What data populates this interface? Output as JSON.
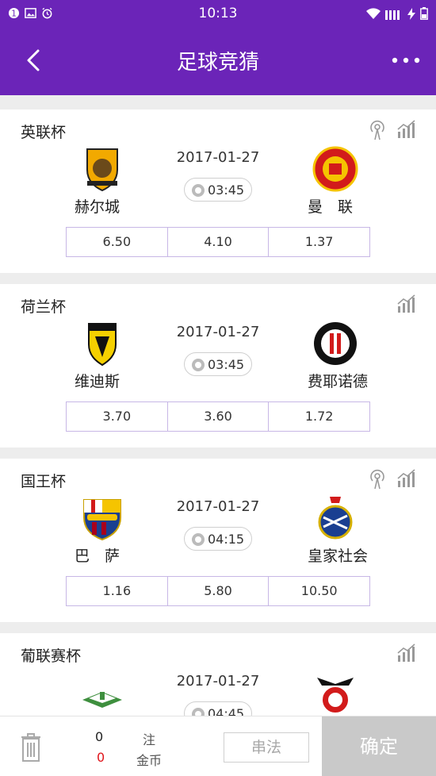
{
  "status_bar": {
    "time": "10:13",
    "left_icons": [
      "notification-badge-icon",
      "image-icon",
      "alarm-icon"
    ],
    "right_icons": [
      "wifi-icon",
      "signal-icon",
      "charging-icon",
      "battery-icon"
    ]
  },
  "header": {
    "title": "足球竞猜",
    "back_icon": "chevron-left-icon",
    "more_icon": "more-icon",
    "color": "#6b24b8"
  },
  "matches": [
    {
      "league": "英联杯",
      "live": true,
      "home": "赫尔城",
      "away": "曼　联",
      "date": "2017-01-27",
      "time": "03:45",
      "odds": [
        "6.50",
        "4.10",
        "1.37"
      ]
    },
    {
      "league": "荷兰杯",
      "live": false,
      "home": "维迪斯",
      "away": "费耶诺德",
      "date": "2017-01-27",
      "time": "03:45",
      "odds": [
        "3.70",
        "3.60",
        "1.72"
      ]
    },
    {
      "league": "国王杯",
      "live": true,
      "home": "巴　萨",
      "away": "皇家社会",
      "date": "2017-01-27",
      "time": "04:15",
      "odds": [
        "1.16",
        "5.80",
        "10.50"
      ]
    },
    {
      "league": "葡联赛杯",
      "live": false,
      "home": "",
      "away": "",
      "date": "2017-01-27",
      "time": "04:45",
      "odds": []
    }
  ],
  "bottom_bar": {
    "bet_count": "0",
    "coin_count": "0",
    "bet_label": "注",
    "coin_label": "金币",
    "combo_label": "串法",
    "confirm_label": "确定"
  }
}
